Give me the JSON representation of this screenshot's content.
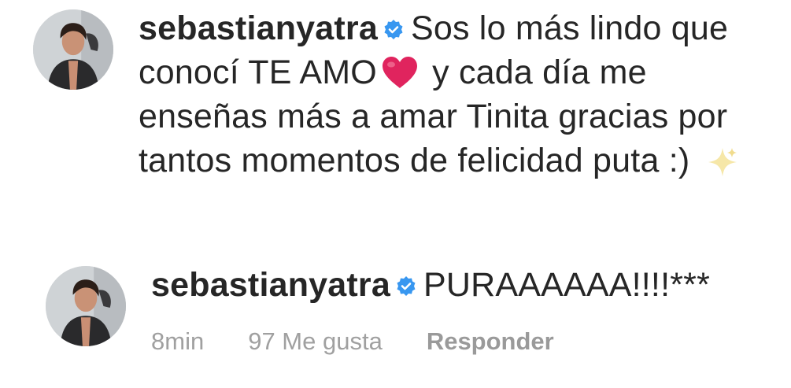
{
  "comments": [
    {
      "username": "sebastianyatra",
      "verified": true,
      "text_parts": {
        "before_heart": "Sos lo más lindo que conocí TE AMO",
        "after_heart": "y cada día me enseñas más a amar Tinita gracias por tantos momentos de felicidad puta :)"
      },
      "emojis": [
        "heart-emoji",
        "sparkle-emoji"
      ]
    },
    {
      "username": "sebastianyatra",
      "verified": true,
      "text": "PURAAAAAA!!!!***",
      "meta": {
        "time": "8min",
        "likes": "97 Me gusta",
        "reply": "Responder"
      }
    }
  ],
  "colors": {
    "text": "#262626",
    "verified_badge": "#3897f0",
    "heart": "#e0245e",
    "meta": "#a0a0a0"
  }
}
